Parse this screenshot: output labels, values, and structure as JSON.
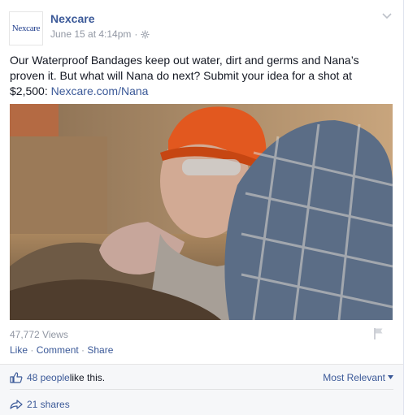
{
  "post": {
    "page_logo_text": "Nexcare",
    "page_name": "Nexcare",
    "timestamp": "June 15 at 4:14pm",
    "meta_separator": "·",
    "text_main": "Our Waterproof Bandages keep out water, dirt and germs and Nana’s proven it. But what will Nana do next? Submit your idea for a shot at $2,500: ",
    "text_link": "Nexcare.com/Nana",
    "views": "47,772 Views",
    "actions": {
      "like": "Like",
      "comment": "Comment",
      "share": "Share",
      "separator": " · "
    }
  },
  "footer": {
    "likes_count": "48 people",
    "likes_suffix": " like this.",
    "sort_label": "Most Relevant",
    "shares": "21 shares"
  },
  "icons": {
    "globe": "globe-icon",
    "chevron": "chevron-down-icon",
    "flag": "flag-icon",
    "like": "thumbs-up-icon",
    "share": "share-arrow-icon",
    "sort_caret": "caret-down-icon"
  },
  "colors": {
    "link": "#3b5998",
    "muted": "#9197a3",
    "text": "#141823",
    "footer_bg": "#f6f7f9"
  }
}
